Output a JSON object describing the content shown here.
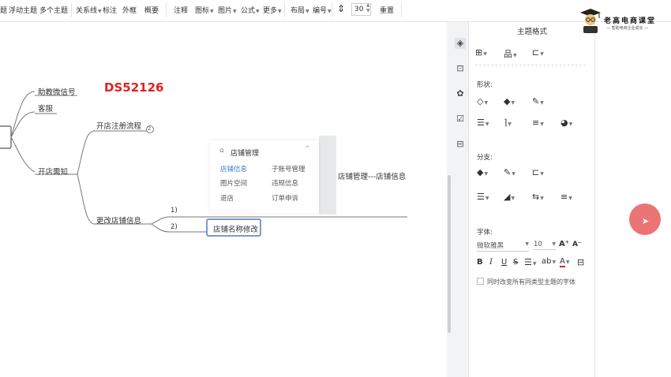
{
  "toolbar": {
    "items": [
      "题",
      "浮动主题",
      "多个主题",
      "关系线",
      "标注",
      "外框",
      "概要",
      "注释",
      "图标",
      "图片",
      "公式",
      "更多",
      "布局",
      "编号",
      "30",
      "重置"
    ]
  },
  "mindmap": {
    "watermark": "DS52126",
    "nodes": {
      "assistant_wechat": "助教微信号",
      "customer_service": "客服",
      "store_notice": "开店需知",
      "registration": "开店注册流程",
      "registration_badge": "2",
      "change_info": "更改店铺信息",
      "step1": "1)",
      "step2": "2)",
      "name_edit": "店铺名称修改",
      "breadcrumb": "店铺管理---店铺信息"
    },
    "accent": "#e02020"
  },
  "store_menu": {
    "title": "店铺管理",
    "items": [
      "店铺信息",
      "子账号管理",
      "图片空间",
      "违规信息",
      "退店",
      "订单申诉"
    ],
    "active_color": "#3a7bd5"
  },
  "panel": {
    "title": "主题格式",
    "shape_label": "形状:",
    "branch_label": "分支:",
    "font_label": "字体:",
    "font_name": "微软雅黑",
    "font_size": "10",
    "sync_label": "同时改变所有同类型主题的字体"
  },
  "logo": {
    "title": "老高电商课堂",
    "subtitle": "— 帮助电商企业成长 —"
  }
}
